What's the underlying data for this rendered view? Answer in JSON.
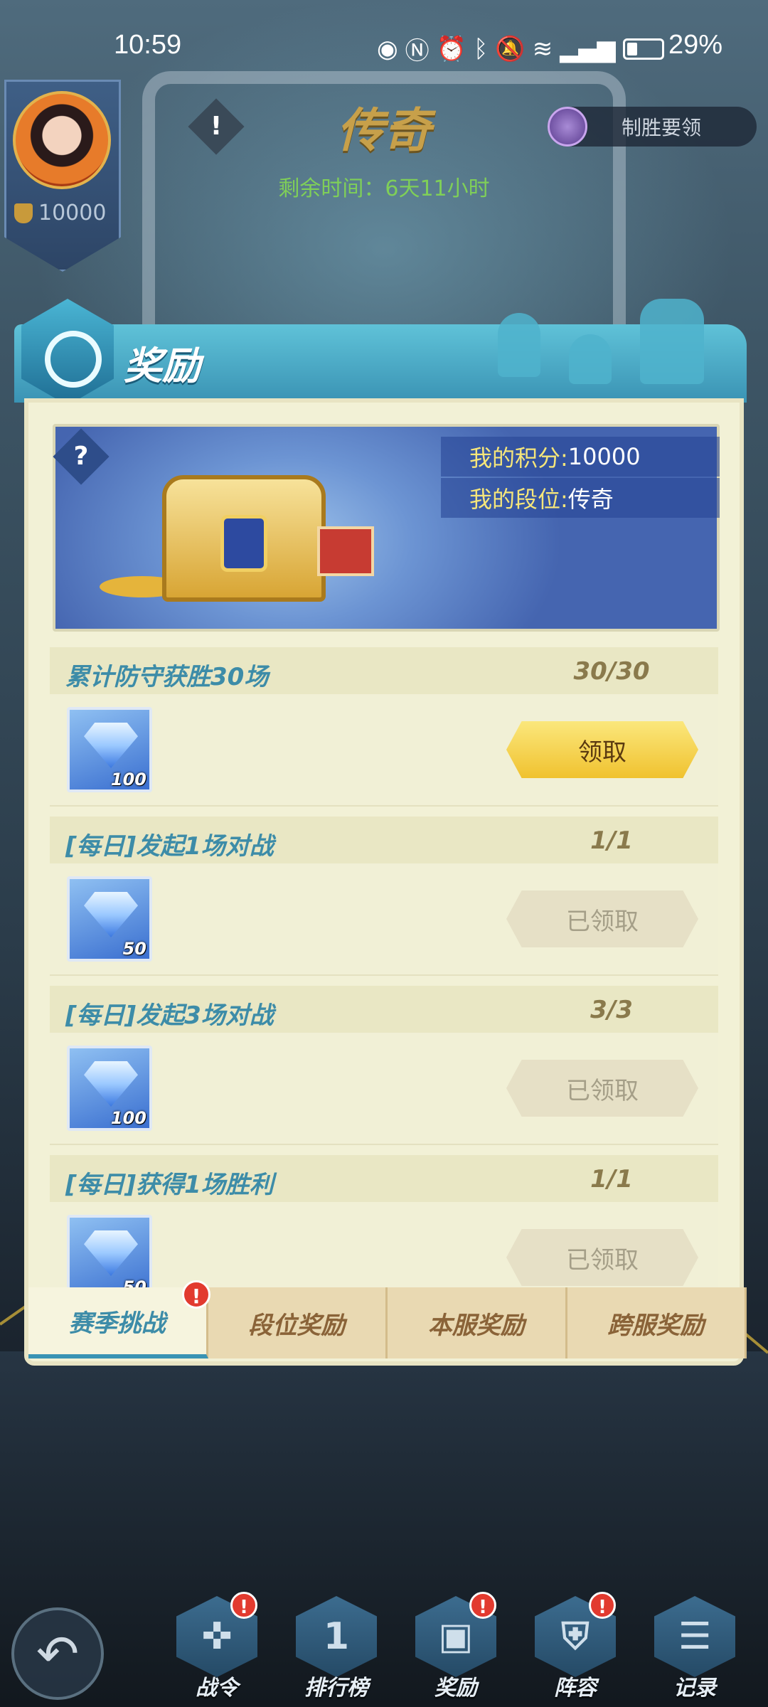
{
  "status_bar": {
    "time": "10:59",
    "battery_text": "29%",
    "icons": [
      "eye-icon",
      "nfc-icon",
      "alarm-icon",
      "bluetooth-icon",
      "mute-icon",
      "wifi-icon",
      "signal-4g-icon",
      "battery-icon"
    ]
  },
  "player": {
    "score": "10000"
  },
  "rank": {
    "title": "传奇",
    "remaining_time": "剩余时间：6天11小时"
  },
  "tips_button": {
    "label": "制胜要领"
  },
  "panel": {
    "title": "奖励"
  },
  "banner": {
    "help": "?",
    "points_label": "我的积分: ",
    "points_value": "10000",
    "rank_label": "我的段位: ",
    "rank_value": "传奇"
  },
  "rewards": [
    {
      "title": "累计防守获胜30场",
      "progress": "30/30",
      "gem_count": "100",
      "button": "领取",
      "state": "claimable"
    },
    {
      "title": "[每日]发起1场对战",
      "progress": "1/1",
      "gem_count": "50",
      "button": "已领取",
      "state": "claimed"
    },
    {
      "title": "[每日]发起3场对战",
      "progress": "3/3",
      "gem_count": "100",
      "button": "已领取",
      "state": "claimed"
    },
    {
      "title": "[每日]获得1场胜利",
      "progress": "1/1",
      "gem_count": "50",
      "button": "已领取",
      "state": "claimed"
    }
  ],
  "tabs": [
    {
      "label": "赛季挑战",
      "active": true,
      "badge": "!"
    },
    {
      "label": "段位奖励",
      "active": false
    },
    {
      "label": "本服奖励",
      "active": false
    },
    {
      "label": "跨服奖励",
      "active": false
    }
  ],
  "bottom_nav": [
    {
      "label": "战令",
      "icon": "compass-icon",
      "badge": "!"
    },
    {
      "label": "排行榜",
      "icon": "rank-one-icon",
      "glyph": "1"
    },
    {
      "label": "奖励",
      "icon": "gift-icon",
      "badge": "!"
    },
    {
      "label": "阵容",
      "icon": "shield-icon",
      "badge": "!"
    },
    {
      "label": "记录",
      "icon": "document-icon"
    }
  ],
  "back_button": {
    "icon": "back-arrow-icon",
    "glyph": "↶"
  },
  "colors": {
    "panel_accent": "#3a93b4",
    "claim_button": "#f0c22f",
    "badge_red": "#e23a2f",
    "rank_gold": "#c7a04a",
    "time_green": "#7fcf58"
  }
}
